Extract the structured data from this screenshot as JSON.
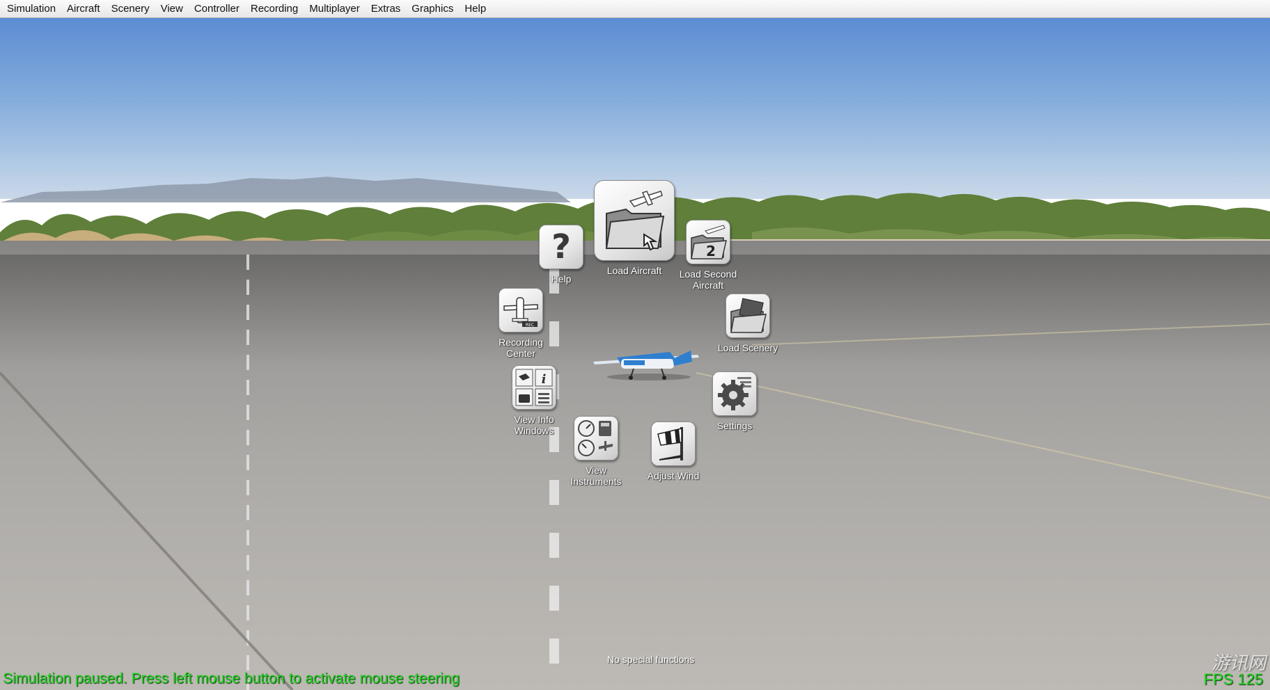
{
  "menubar": {
    "items": [
      "Simulation",
      "Aircraft",
      "Scenery",
      "View",
      "Controller",
      "Recording",
      "Multiplayer",
      "Extras",
      "Graphics",
      "Help"
    ]
  },
  "radial_menu": {
    "load_aircraft": "Load Aircraft",
    "help": "Help",
    "load_second_aircraft": "Load Second\nAircraft",
    "recording_center": "Recording\nCenter",
    "load_scenery": "Load Scenery",
    "view_info_windows": "View Info\nWindows",
    "settings": "Settings",
    "view_instruments": "View\nInstruments",
    "adjust_wind": "Adjust Wind",
    "second_aircraft_number": "2"
  },
  "status": {
    "message": "Simulation paused. Press left mouse button to activate mouse steering",
    "special_functions": "No special functions",
    "fps": "FPS 125",
    "watermark": "游讯网"
  },
  "colors": {
    "status_green": "#1fd21f",
    "label_white": "#ffffff"
  },
  "icons": {
    "load_aircraft": "folder-airplane-icon",
    "help": "question-mark-icon",
    "load_second_aircraft": "folder-airplane-2-icon",
    "recording_center": "airplane-rec-icon",
    "load_scenery": "folder-landscape-icon",
    "view_info_windows": "info-windows-icon",
    "settings": "gear-icon",
    "view_instruments": "instruments-icon",
    "adjust_wind": "windsock-icon"
  }
}
